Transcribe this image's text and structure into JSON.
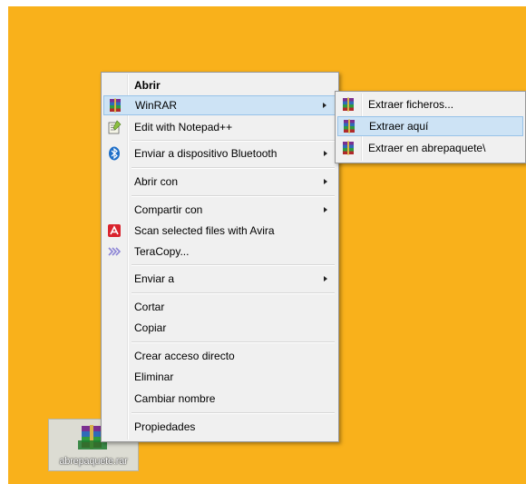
{
  "desktop": {
    "background": "#f9b11b",
    "icon_label": "abrepaquete.rar",
    "icon": "winrar-archive-icon"
  },
  "context_menu": {
    "items": [
      {
        "label": "Abrir",
        "icon": null
      },
      {
        "label": "WinRAR",
        "icon": "winrar-icon"
      },
      {
        "label": "Edit with Notepad++",
        "icon": "notepad-plus-plus-icon"
      },
      {
        "label": "Enviar a dispositivo Bluetooth",
        "icon": "bluetooth-icon"
      },
      {
        "label": "Abrir con",
        "icon": null
      },
      {
        "label": "Compartir con",
        "icon": null
      },
      {
        "label": "Scan selected files with Avira",
        "icon": "avira-icon"
      },
      {
        "label": "TeraCopy...",
        "icon": "teracopy-icon"
      },
      {
        "label": "Enviar a",
        "icon": null
      },
      {
        "label": "Cortar",
        "icon": null
      },
      {
        "label": "Copiar",
        "icon": null
      },
      {
        "label": "Crear acceso directo",
        "icon": null
      },
      {
        "label": "Eliminar",
        "icon": null
      },
      {
        "label": "Cambiar nombre",
        "icon": null
      },
      {
        "label": "Propiedades",
        "icon": null
      }
    ],
    "highlighted": "WinRAR"
  },
  "winrar_submenu": {
    "items": [
      {
        "label": "Extraer ficheros...",
        "icon": "winrar-icon"
      },
      {
        "label": "Extraer aquí",
        "icon": "winrar-icon"
      },
      {
        "label": "Extraer en abrepaquete\\",
        "icon": "winrar-icon"
      }
    ],
    "highlighted": "Extraer aquí"
  },
  "colors": {
    "menu_bg": "#f0f0f0",
    "highlight_bg": "#cde3f5",
    "highlight_border": "#98c2e8"
  }
}
